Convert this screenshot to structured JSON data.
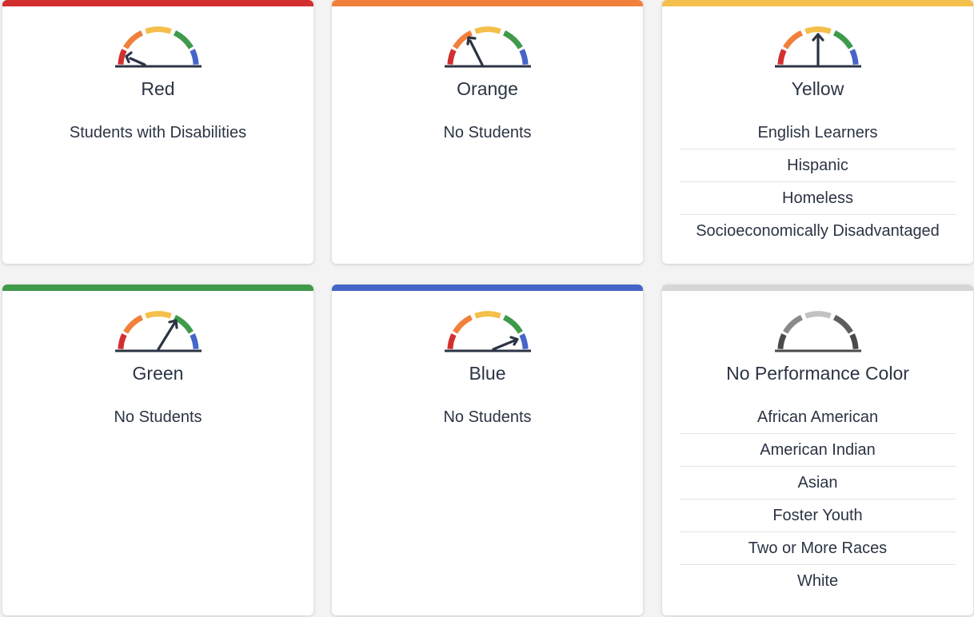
{
  "colors": {
    "red": "#d32f2f",
    "orange": "#f0803c",
    "yellow": "#f4bf4a",
    "green": "#3f9a4b",
    "blue": "#4565c8",
    "gray": "#d6d6d6",
    "needle": "#2b3444"
  },
  "cards": [
    {
      "title": "Red",
      "groups": [
        "Students with Disabilities"
      ],
      "level": "red"
    },
    {
      "title": "Orange",
      "groups": [
        "No Students"
      ],
      "level": "orange"
    },
    {
      "title": "Yellow",
      "groups": [
        "English Learners",
        "Hispanic",
        "Homeless",
        "Socioeconomically Disadvantaged"
      ],
      "level": "yellow"
    },
    {
      "title": "Green",
      "groups": [
        "No Students"
      ],
      "level": "green"
    },
    {
      "title": "Blue",
      "groups": [
        "No Students"
      ],
      "level": "blue"
    },
    {
      "title": "No Performance Color",
      "groups": [
        "African American",
        "American Indian",
        "Asian",
        "Foster Youth",
        "Two or More Races",
        "White"
      ],
      "level": "none"
    }
  ]
}
